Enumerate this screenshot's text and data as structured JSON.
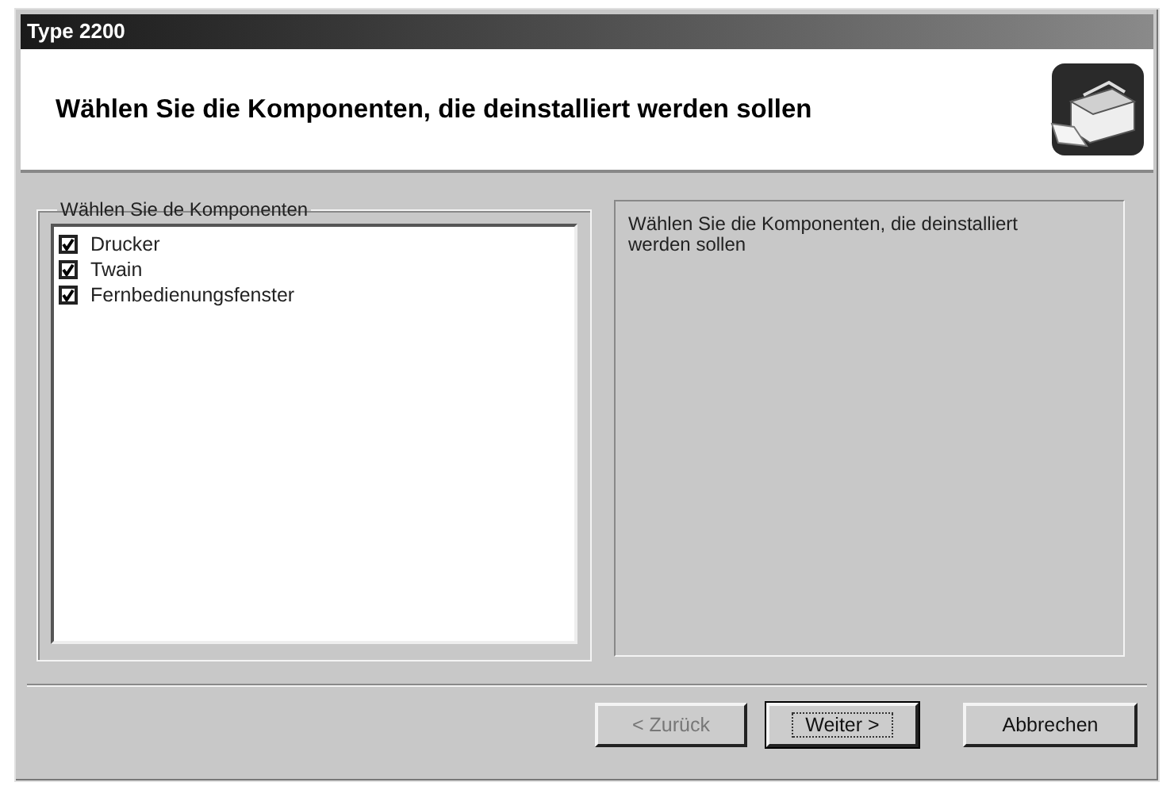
{
  "window": {
    "title": "Type 2200"
  },
  "header": {
    "title": "Wählen Sie die Komponenten, die deinstalliert werden sollen"
  },
  "components": {
    "label": "Wählen Sie de Komponenten",
    "items": [
      {
        "label": "Drucker",
        "checked": true
      },
      {
        "label": "Twain",
        "checked": true
      },
      {
        "label": "Fernbedienungsfenster",
        "checked": true
      }
    ]
  },
  "description": "Wählen Sie die Komponenten, die deinstalliert werden sollen",
  "buttons": [
    {
      "label": "< Zurück",
      "disabled": true,
      "default": false
    },
    {
      "label": "Weiter >",
      "disabled": false,
      "default": true
    },
    {
      "label": "Abbrechen",
      "disabled": false,
      "default": false
    }
  ]
}
